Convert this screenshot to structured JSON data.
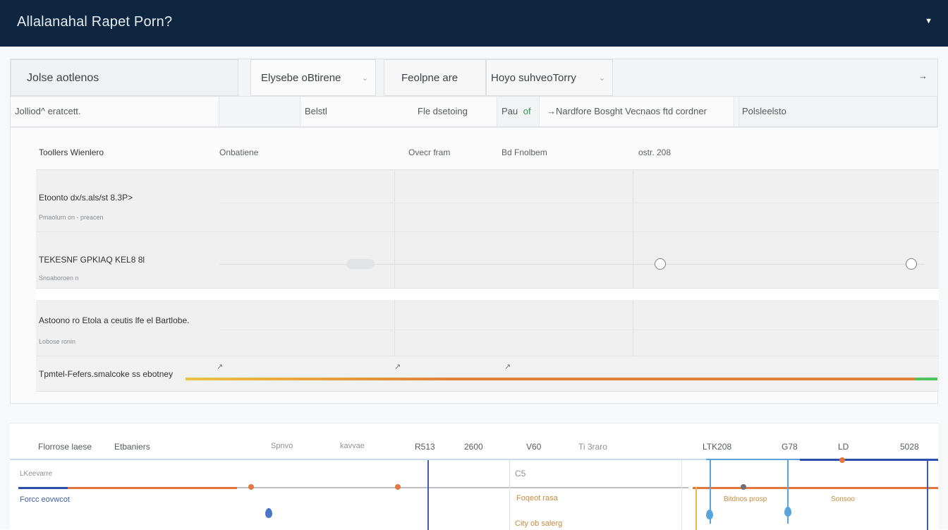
{
  "app": {
    "title": "Allalanahal Rapet Porn?",
    "menu_icon": "chevron-down-icon"
  },
  "toolbar": {
    "search_label": "Jolse aotlenos",
    "dropdown1": "Elysebe oBtirene",
    "dropdown2": "Feolpne are",
    "dropdown3": "Hoyo suhveoTorry",
    "arrow_icon": "arrow-right-icon"
  },
  "filters": {
    "f1": "Jolliod^ eratcett.",
    "f2": "Belstl",
    "f3": "Fle dsetoing",
    "f4a": "Pau",
    "f4b": "of",
    "f5": "→Nardfore Bosght Vecnaos ftd cordner",
    "f6": "Polsleelsto"
  },
  "table": {
    "headers": [
      "Toollers Wienlero",
      "Onbatiene",
      "Ovecr fram",
      "Bd Fnolbem",
      "ostr. 208"
    ],
    "rows": [
      {
        "title": "Etoonto dx/s.als/st 8.3P>",
        "sub": "Pmaolurn on - preacen"
      },
      {
        "title": "TEKESNF GPKIAQ KEL8 8l",
        "sub": "Snoaboroen n"
      },
      {
        "title": "Astoono ro Etola a ceutis lfe el Bartlobe.",
        "sub": "Lobose ronin"
      }
    ],
    "footer_label": "Tpmtel-Fefers.smalcoke ss ebotney",
    "footer_markers": [
      "↗",
      "↗",
      "↗"
    ],
    "colors": {
      "progress_start": "#e9c243",
      "progress_mid": "#e0823d",
      "progress_end": "#4ec35c"
    }
  },
  "timeline": {
    "header_left_a": "Florrose laese",
    "header_left_b": "Etbaniers",
    "ticks": [
      "Spnvo",
      "kavvae",
      "R513",
      "2600",
      "V60",
      "Ti 3raro",
      "LTK208",
      "G78",
      "LD",
      "5028"
    ],
    "legend1": "LKeevarre",
    "legend2": "Forcc eovwcot",
    "mid_a": "C5",
    "mid_b": "Foqeot rasa",
    "mid_c": "City ob salerg",
    "right_a": "Bitdnos prosp",
    "right_b": "Sonsoo",
    "colors": {
      "blue": "#2f4fb0",
      "orange": "#e2763e",
      "gold": "#e7b94a",
      "sky": "#5aa4dc"
    }
  }
}
